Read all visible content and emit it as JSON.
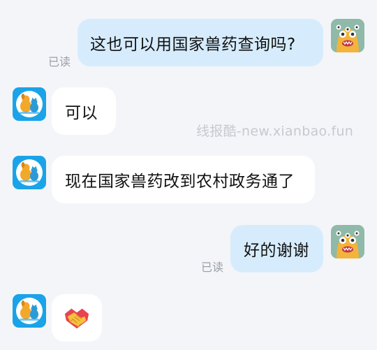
{
  "messages": [
    {
      "direction": "outgoing",
      "sender": "user",
      "text": "这也可以用国家兽药查询吗?",
      "status": "已读"
    },
    {
      "direction": "incoming",
      "sender": "service",
      "text": "可以"
    },
    {
      "direction": "incoming",
      "sender": "service",
      "text": "现在国家兽药改到农村政务通了"
    },
    {
      "direction": "outgoing",
      "sender": "user",
      "text": "好的谢谢",
      "status": "已读"
    },
    {
      "direction": "incoming",
      "sender": "service",
      "text": "",
      "emoji": "handshake"
    }
  ],
  "watermark": "线报酷-new.xianbao.fun",
  "colors": {
    "background": "#f4f5f9",
    "outgoing_bubble": "#d6ecfd",
    "incoming_bubble": "#ffffff",
    "service_avatar_bg": "#1aa3e8",
    "user_avatar_bg": "#8fb9a8"
  },
  "icons": {
    "user_avatar": "monster-avatar-icon",
    "service_avatar": "dog-cat-logo-icon",
    "emoji": "handshake-icon"
  }
}
